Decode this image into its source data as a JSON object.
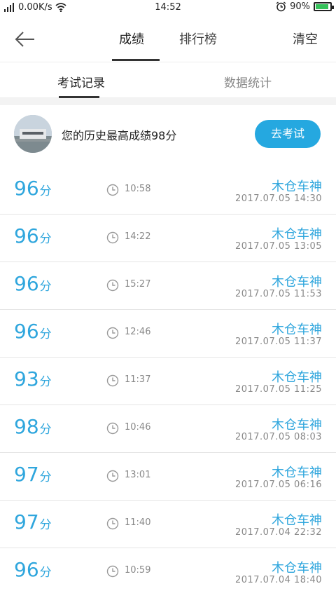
{
  "status_bar": {
    "network_speed": "0.00K/s",
    "time": "14:52",
    "battery": "90%",
    "battery_level": 0.9
  },
  "header": {
    "tabs": [
      {
        "label": "成绩"
      },
      {
        "label": "排行榜"
      }
    ],
    "clear_label": "清空"
  },
  "subtabs": [
    {
      "label": "考试记录"
    },
    {
      "label": "数据统计"
    }
  ],
  "best": {
    "text": "您的历史最高成绩98分",
    "button_label": "去考试"
  },
  "records": [
    {
      "score": "96",
      "unit": "分",
      "duration": "10:58",
      "location": "木仓车神",
      "datetime": "2017.07.05  14:30"
    },
    {
      "score": "96",
      "unit": "分",
      "duration": "14:22",
      "location": "木仓车神",
      "datetime": "2017.07.05  13:05"
    },
    {
      "score": "96",
      "unit": "分",
      "duration": "15:27",
      "location": "木仓车神",
      "datetime": "2017.07.05  11:53"
    },
    {
      "score": "96",
      "unit": "分",
      "duration": "12:46",
      "location": "木仓车神",
      "datetime": "2017.07.05  11:37"
    },
    {
      "score": "93",
      "unit": "分",
      "duration": "11:37",
      "location": "木仓车神",
      "datetime": "2017.07.05  11:25"
    },
    {
      "score": "98",
      "unit": "分",
      "duration": "10:46",
      "location": "木仓车神",
      "datetime": "2017.07.05  08:03"
    },
    {
      "score": "97",
      "unit": "分",
      "duration": "13:01",
      "location": "木仓车神",
      "datetime": "2017.07.05  06:16"
    },
    {
      "score": "97",
      "unit": "分",
      "duration": "11:40",
      "location": "木仓车神",
      "datetime": "2017.07.04  22:32"
    },
    {
      "score": "96",
      "unit": "分",
      "duration": "10:59",
      "location": "木仓车神",
      "datetime": "2017.07.04  18:40"
    }
  ],
  "colors": {
    "accent": "#2fa6dd",
    "button": "#25a8e0",
    "battery_fill": "#35c15a"
  }
}
